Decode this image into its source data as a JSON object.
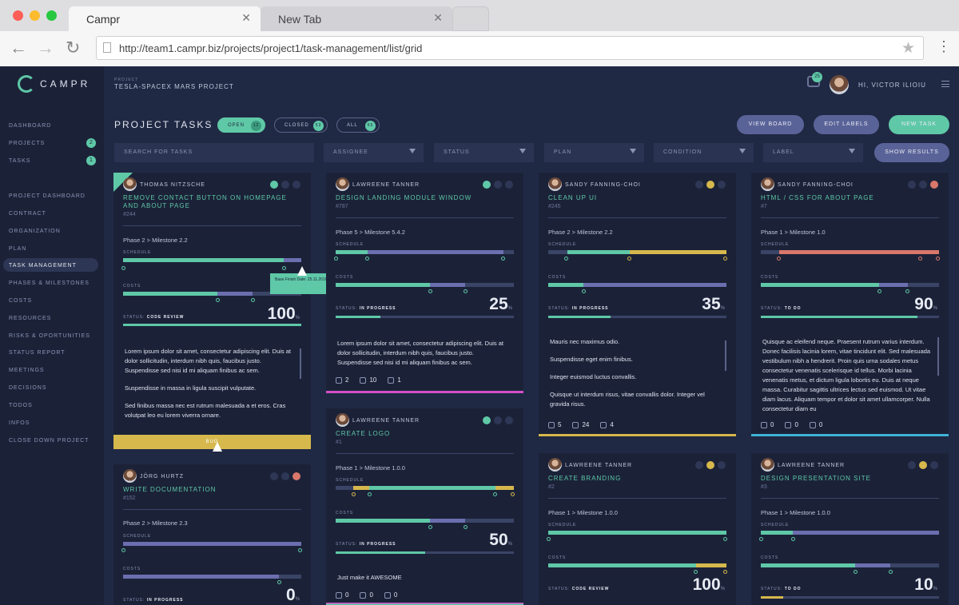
{
  "browser": {
    "tabs": [
      {
        "label": "Campr"
      },
      {
        "label": "New Tab"
      }
    ],
    "url": "http://team1.campr.biz/projects/project1/task-management/list/grid"
  },
  "app": {
    "logo": "CAMPR",
    "project_label": "PROJECT",
    "project_name": "TESLA-SPACEX MARS PROJECT",
    "chat_count": "25",
    "user_greeting": "HI, VICTOR ILIOIU"
  },
  "sidebar": {
    "items": [
      {
        "label": "DASHBOARD"
      },
      {
        "label": "PROJECTS",
        "badge": "2"
      },
      {
        "label": "TASKS",
        "badge": "1"
      },
      {
        "label": "PROJECT DASHBOARD"
      },
      {
        "label": "CONTRACT"
      },
      {
        "label": "ORGANIZATION"
      },
      {
        "label": "PLAN"
      },
      {
        "label": "TASK MANAGEMENT"
      },
      {
        "label": "PHASES & MILESTONES"
      },
      {
        "label": "COSTS"
      },
      {
        "label": "RESOURCES"
      },
      {
        "label": "RISKS & OPORTUNITIES"
      },
      {
        "label": "STATUS REPORT"
      },
      {
        "label": "MEETINGS"
      },
      {
        "label": "DECISIONS"
      },
      {
        "label": "TODOS"
      },
      {
        "label": "INFOS"
      },
      {
        "label": "CLOSE DOWN PROJECT"
      }
    ]
  },
  "toolbar": {
    "title": "PROJECT TASKS",
    "open_label": "OPEN",
    "open_count": "12",
    "closed_label": "CLOSED",
    "closed_count": "53",
    "all_label": "ALL",
    "all_count": "65",
    "view_board": "VIEW BOARD",
    "edit_labels": "EDIT LABELS",
    "new_task": "NEW TASK"
  },
  "filters": {
    "search_placeholder": "SEARCH FOR TASKS",
    "assignee": "ASSIGNEE",
    "status": "STATUS",
    "plan": "PLAN",
    "condition": "CONDITION",
    "label": "LABEL",
    "show_results": "SHOW RESULTS"
  },
  "labels": {
    "schedule": "SCHEDULE",
    "costs": "COSTS",
    "status": "STATUS:",
    "pct_sign": "%",
    "bug": "BUG",
    "tooltip": "Base Finish Date: 25.11.2016"
  },
  "cards": [
    {
      "name": "THOMAS NITZSCHE",
      "title": "REMOVE CONTACT BUTTON ON HOMEPAGE AND ABOUT PAGE",
      "id": "#244",
      "phase": "Phase 2 > Milestone 2.2",
      "status": "CODE REVIEW",
      "percent": "100",
      "desc": [
        "Lorem ipsum dolor sit amet, consectetur adipiscing elit. Duis at dolor sollicitudin, interdum nibh quis, faucibus justo. Suspendisse sed nisi id mi aliquam finibus ac sem.",
        "Suspendisse in massa in ligula suscipit vulputate.",
        "Sed finibus massa nec est rutrum malesuada a et eros. Cras volutpat leo eu lorem viverra ornare."
      ]
    },
    {
      "name": "LAWREENE TANNER",
      "title": "DESIGN LANDING MODULE WINDOW",
      "id": "#787",
      "phase": "Phase 5 > Milestone 5.4.2",
      "status": "IN PROGRESS",
      "percent": "25",
      "desc": [
        "Lorem ipsum dolor sit amet, consectetur adipiscing elit. Duis at dolor sollicitudin, interdum nibh quis, faucibus justo. Suspendisse sed nisi id mi aliquam finibus ac sem."
      ],
      "attach": "2",
      "comments": "10",
      "todos": "1"
    },
    {
      "name": "SANDY FANNING-CHOI",
      "title": "CLEAN UP UI",
      "id": "#245",
      "phase": "Phase 2 > Milestone 2.2",
      "status": "IN PROGRESS",
      "percent": "35",
      "desc": [
        "Mauris nec maximus odio.",
        "Suspendisse eget enim finibus.",
        "Integer euismod luctus convallis.",
        "Quisque ut interdum risus, vitae convallis dolor. Integer vel gravida risus."
      ],
      "attach": "5",
      "comments": "24",
      "todos": "4"
    },
    {
      "name": "SANDY FANNING-CHOI",
      "title": "HTML / CSS FOR ABOUT PAGE",
      "id": "#7",
      "phase": "Phase 1 > Milestone 1.0",
      "status": "TO DO",
      "percent": "90",
      "desc": [
        "Quisque ac eleifend neque. Praesent rutrum varius interdum. Donec facilisis lacinia lorem, vitae tincidunt elit. Sed malesuada vestibulum nibh a hendrerit. Proin quis urna sodales metus consectetur venenatis scelerisque id tellus. Morbi lacinia venenatis metus, et dictum ligula lobortis eu. Duis at neque massa. Curabitur sagittis ultrices lectus sed euismod. Ut vitae diam lacus. Aliquam tempor et dolor sit amet ullamcorper. Nulla consectetur diam eu"
      ],
      "attach": "0",
      "comments": "0",
      "todos": "0"
    },
    {
      "name": "JÖRG HURTZ",
      "title": "WRITE DOCUMENTATION",
      "id": "#152",
      "phase": "Phase 2 > Milestone 2.3",
      "status": "IN PROGRESS",
      "percent": "0"
    },
    {
      "name": "LAWREENE TANNER",
      "title": "CREATE LOGO",
      "id": "#1",
      "phase": "Phase 1 > Milestone 1.0.0",
      "status": "IN PROGRESS",
      "percent": "50",
      "desc": [
        "Just make it AWESOME"
      ],
      "attach": "0",
      "comments": "0",
      "todos": "0"
    },
    {
      "name": "LAWREENE TANNER",
      "title": "CREATE BRANDING",
      "id": "#2",
      "phase": "Phase 1 > Milestone 1.0.0",
      "status": "CODE REVIEW",
      "percent": "100"
    },
    {
      "name": "LAWREENE TANNER",
      "title": "DESIGN PRESENTATION SITE",
      "id": "#3",
      "phase": "Phase 1 > Milestone 1.0.0",
      "status": "TO DO",
      "percent": "10"
    }
  ],
  "colors": {
    "accent": "#5fc8a7",
    "purple": "#6b6fb0",
    "yellow": "#d6b84c",
    "red": "#d8776a",
    "pink": "#d24fc6",
    "blue": "#3fb3d6"
  }
}
